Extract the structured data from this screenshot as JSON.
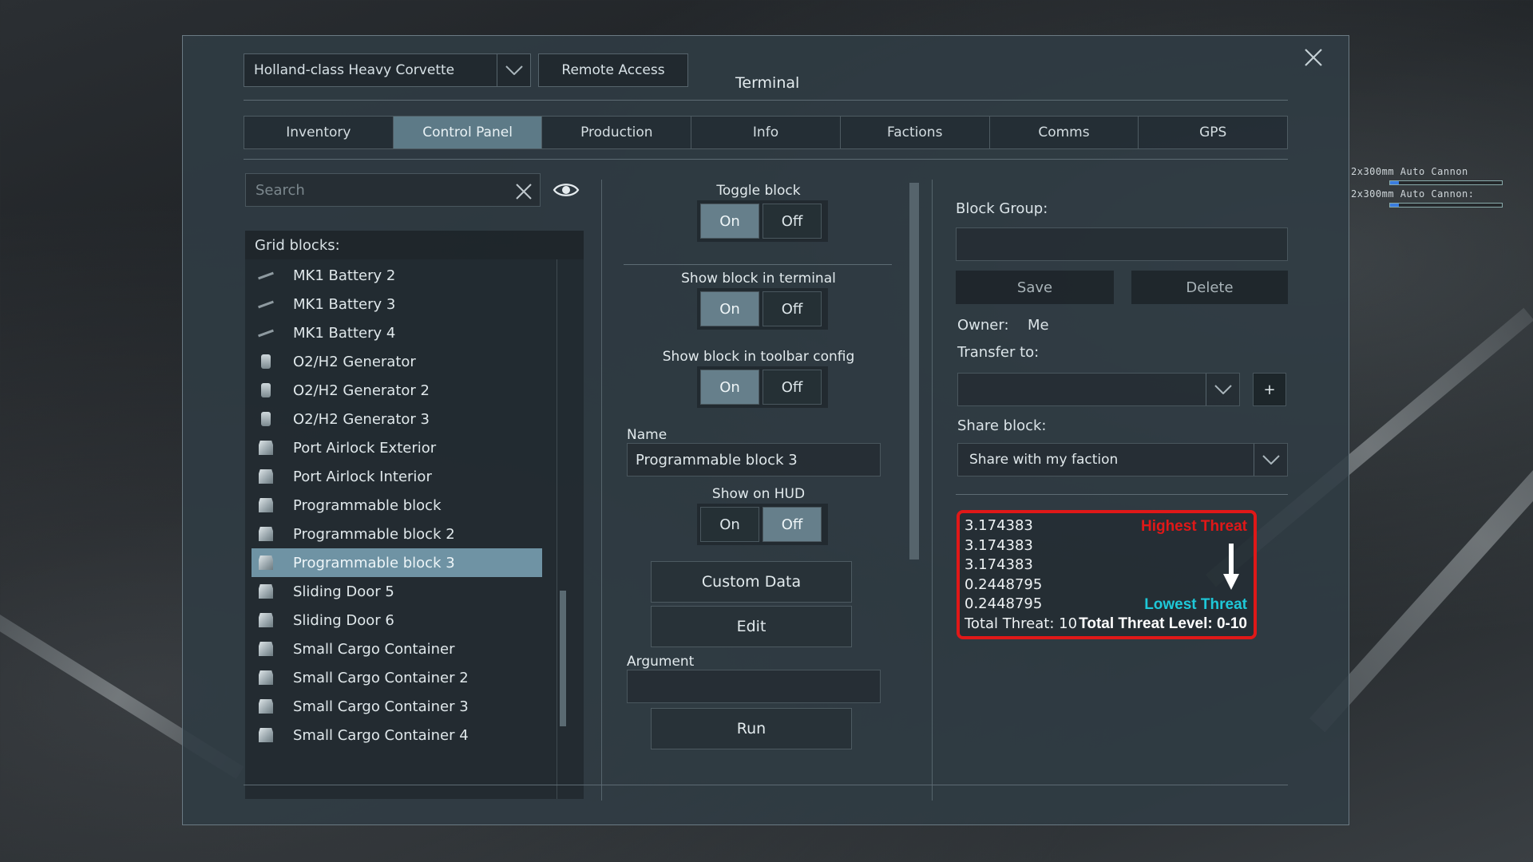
{
  "hud": {
    "weapon_lines": [
      "2x300mm Auto Cannon",
      "2x300mm Auto Cannon:"
    ]
  },
  "header": {
    "grid_name": "Holland-class Heavy Corvette",
    "remote_access_label": "Remote Access",
    "title": "Terminal"
  },
  "tabs": [
    {
      "label": "Inventory",
      "active": false
    },
    {
      "label": "Control Panel",
      "active": true
    },
    {
      "label": "Production",
      "active": false
    },
    {
      "label": "Info",
      "active": false
    },
    {
      "label": "Factions",
      "active": false
    },
    {
      "label": "Comms",
      "active": false
    },
    {
      "label": "GPS",
      "active": false
    }
  ],
  "search": {
    "placeholder": "Search"
  },
  "grid_blocks": {
    "header": "Grid blocks:",
    "items": [
      {
        "label": "MK1 Battery 2",
        "icon": "battery-icon"
      },
      {
        "label": "MK1 Battery 3",
        "icon": "battery-icon"
      },
      {
        "label": "MK1 Battery 4",
        "icon": "battery-icon"
      },
      {
        "label": "O2/H2 Generator",
        "icon": "generator-icon"
      },
      {
        "label": "O2/H2 Generator 2",
        "icon": "generator-icon"
      },
      {
        "label": "O2/H2 Generator 3",
        "icon": "generator-icon"
      },
      {
        "label": "Port Airlock Exterior",
        "icon": "block-icon"
      },
      {
        "label": "Port Airlock Interior",
        "icon": "block-icon"
      },
      {
        "label": "Programmable block",
        "icon": "block-icon"
      },
      {
        "label": "Programmable block 2",
        "icon": "block-icon"
      },
      {
        "label": "Programmable block 3",
        "icon": "block-icon",
        "selected": true
      },
      {
        "label": "Sliding Door 5",
        "icon": "block-icon"
      },
      {
        "label": "Sliding Door 6",
        "icon": "block-icon"
      },
      {
        "label": "Small Cargo Container",
        "icon": "block-icon"
      },
      {
        "label": "Small Cargo Container 2",
        "icon": "block-icon"
      },
      {
        "label": "Small Cargo Container 3",
        "icon": "block-icon"
      },
      {
        "label": "Small Cargo Container 4",
        "icon": "block-icon"
      }
    ]
  },
  "controls": {
    "toggle_block": {
      "label": "Toggle block",
      "on": "On",
      "off": "Off",
      "value": "On"
    },
    "show_in_terminal": {
      "label": "Show block in terminal",
      "on": "On",
      "off": "Off",
      "value": "On"
    },
    "show_in_toolbar": {
      "label": "Show block in toolbar config",
      "on": "On",
      "off": "Off",
      "value": "On"
    },
    "name_label": "Name",
    "name_value": "Programmable block 3",
    "show_on_hud": {
      "label": "Show on HUD",
      "on": "On",
      "off": "Off",
      "value": "Off"
    },
    "custom_data_label": "Custom Data",
    "edit_label": "Edit",
    "argument_label": "Argument",
    "argument_value": "",
    "run_label": "Run"
  },
  "block_group": {
    "label": "Block Group:",
    "value": "",
    "save_label": "Save",
    "delete_label": "Delete"
  },
  "ownership": {
    "owner_label": "Owner:",
    "owner_value": "Me",
    "transfer_label": "Transfer to:",
    "transfer_value": "",
    "plus_label": "+",
    "share_label": "Share block:",
    "share_value": "Share with my faction"
  },
  "threat_panel": {
    "lines": [
      "3.174383",
      "3.174383",
      "3.174383",
      "0.2448795",
      "0.2448795",
      "Total Threat: 10"
    ],
    "highest_label": "Highest Threat",
    "lowest_label": "Lowest Threat",
    "total_level_label": "Total Threat Level: 0-10",
    "colors": {
      "border": "#e01818",
      "highest": "#e01818",
      "lowest": "#1ec8d8"
    }
  },
  "colors": {
    "accent_active_tab": "#5d7a87",
    "selected_item": "#6f93a4"
  }
}
